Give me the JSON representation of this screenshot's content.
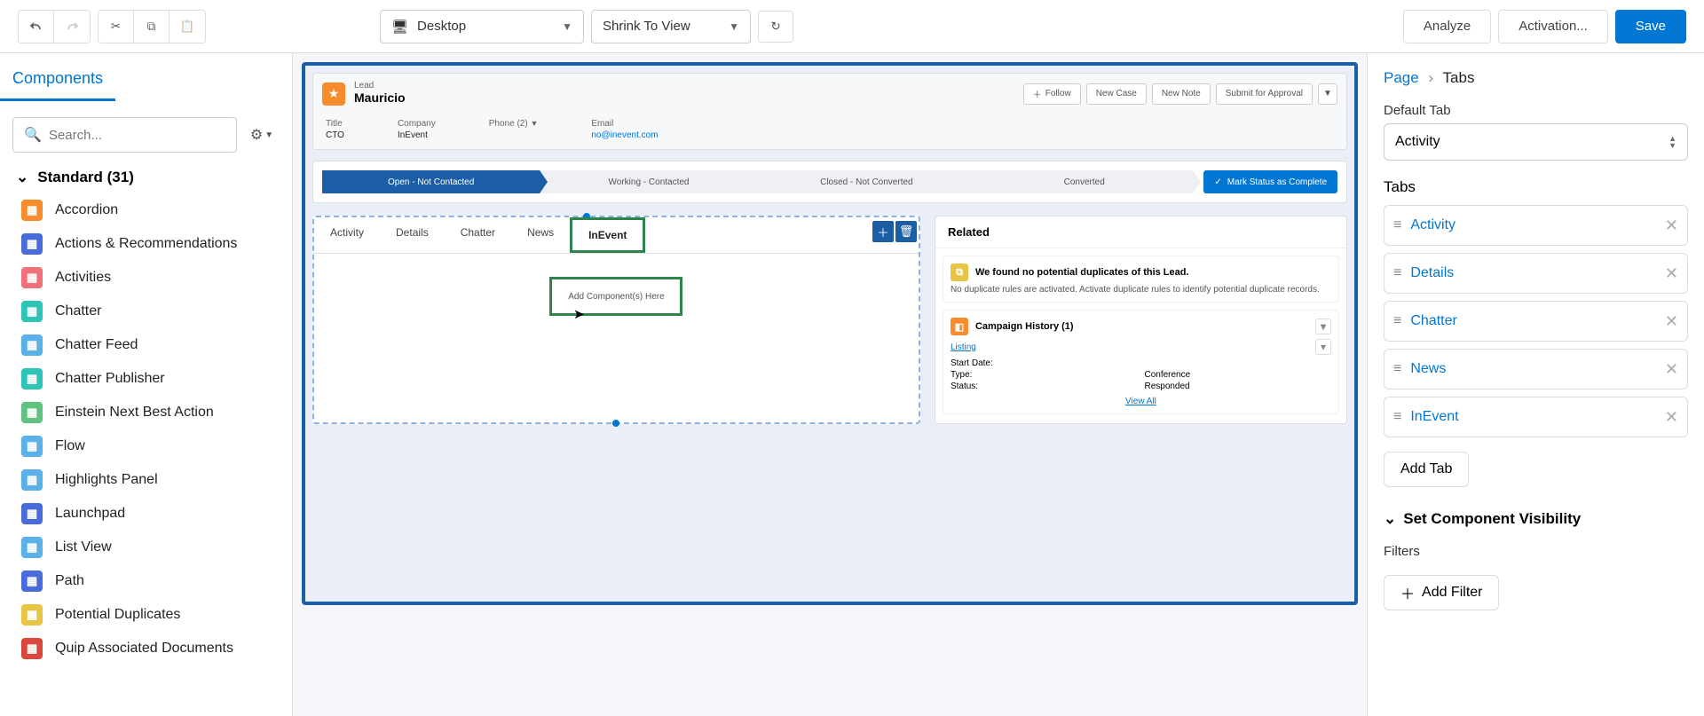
{
  "toolbar": {
    "device_label": "Desktop",
    "zoom_label": "Shrink To View",
    "analyze": "Analyze",
    "activation": "Activation...",
    "save": "Save"
  },
  "left": {
    "tab": "Components",
    "search_placeholder": "Search...",
    "section_label": "Standard (31)",
    "items": [
      {
        "label": "Accordion",
        "color": "#f88b2c"
      },
      {
        "label": "Actions & Recommendations",
        "color": "#4a6bdc"
      },
      {
        "label": "Activities",
        "color": "#f2707a"
      },
      {
        "label": "Chatter",
        "color": "#2ec4b6"
      },
      {
        "label": "Chatter Feed",
        "color": "#5ab0e8"
      },
      {
        "label": "Chatter Publisher",
        "color": "#2ec4b6"
      },
      {
        "label": "Einstein Next Best Action",
        "color": "#5fc27e"
      },
      {
        "label": "Flow",
        "color": "#5ab0e8"
      },
      {
        "label": "Highlights Panel",
        "color": "#5ab0e8"
      },
      {
        "label": "Launchpad",
        "color": "#4a6bdc"
      },
      {
        "label": "List View",
        "color": "#5ab0e8"
      },
      {
        "label": "Path",
        "color": "#4a6bdc"
      },
      {
        "label": "Potential Duplicates",
        "color": "#e8c444"
      },
      {
        "label": "Quip Associated Documents",
        "color": "#d9483b"
      }
    ]
  },
  "canvas": {
    "record": {
      "object": "Lead",
      "name": "Mauricio",
      "actions": {
        "follow": "Follow",
        "new_case": "New Case",
        "new_note": "New Note",
        "submit": "Submit for Approval"
      },
      "fields": {
        "title_l": "Title",
        "title_v": "CTO",
        "company_l": "Company",
        "company_v": "InEvent",
        "phone_l": "Phone (2)",
        "email_l": "Email",
        "email_v": "no@inevent.com"
      }
    },
    "path": {
      "stages": [
        "Open - Not Contacted",
        "Working - Contacted",
        "Closed - Not Converted",
        "Converted"
      ],
      "complete": "Mark Status as Complete"
    },
    "tabs": {
      "items": [
        "Activity",
        "Details",
        "Chatter",
        "News",
        "InEvent"
      ],
      "drop_text": "Add Component(s) Here"
    },
    "related": {
      "header": "Related",
      "dup": {
        "title": "We found no potential duplicates of this Lead.",
        "body": "No duplicate rules are activated. Activate duplicate rules to identify potential duplicate records."
      },
      "camp": {
        "title": "Campaign History (1)",
        "link": "Listing",
        "k1": "Start Date:",
        "v1": "",
        "k2": "Type:",
        "v2": "Conference",
        "k3": "Status:",
        "v3": "Responded",
        "view": "View All"
      }
    }
  },
  "right": {
    "bc_page": "Page",
    "bc_cur": "Tabs",
    "default_label": "Default Tab",
    "default_value": "Activity",
    "tabs_label": "Tabs",
    "tabs": [
      "Activity",
      "Details",
      "Chatter",
      "News",
      "InEvent"
    ],
    "add_tab": "Add Tab",
    "vis": "Set Component Visibility",
    "filters": "Filters",
    "add_filter": "Add Filter"
  }
}
